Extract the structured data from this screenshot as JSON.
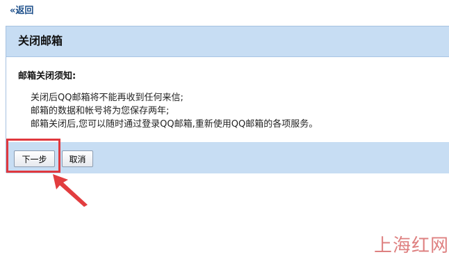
{
  "back_link": {
    "label": "«返回"
  },
  "panel": {
    "title": "关闭邮箱",
    "notice_heading": "邮箱关闭须知:",
    "notice_lines": [
      "关闭后QQ邮箱将不能再收到任何来信;",
      "邮箱的数据和帐号将为您保存两年;",
      "邮箱关闭后,您可以随时通过登录QQ邮箱,重新使用QQ邮箱的各项服务。"
    ]
  },
  "buttons": {
    "next_label": "下一步",
    "cancel_label": "取消"
  },
  "annotation": {
    "highlight_color": "#e0383e"
  },
  "watermark": {
    "text": "上海红网"
  },
  "colors": {
    "header_bg": "#c7ddf3",
    "link": "#1d4f8a"
  }
}
